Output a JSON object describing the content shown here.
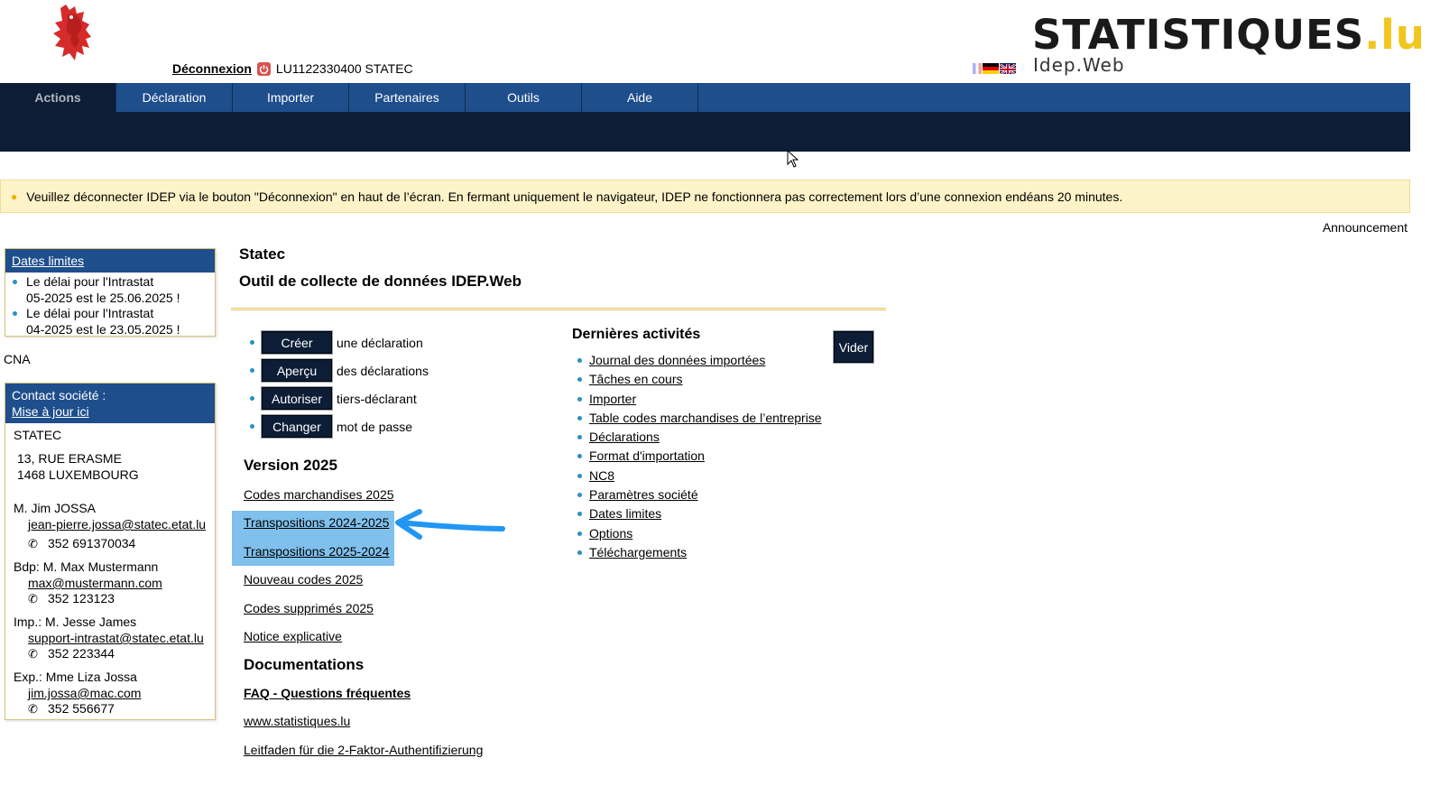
{
  "header": {
    "logout_label": "Déconnexion",
    "user_id": "LU1122330400 STATEC",
    "brand_main": "STATISTIQUES",
    "brand_tld": ".lu",
    "brand_sub": "Idep.Web"
  },
  "nav": {
    "items": [
      {
        "label": "Actions",
        "active": true
      },
      {
        "label": "Déclaration"
      },
      {
        "label": "Importer"
      },
      {
        "label": "Partenaires"
      },
      {
        "label": "Outils"
      },
      {
        "label": "Aide"
      }
    ]
  },
  "alert": {
    "text": "Veuillez déconnecter IDEP via le bouton \"Déconnexion\" en haut de l’écran. En fermant uniquement le navigateur, IDEP ne fonctionnera pas correctement lors d’une connexion endéans 20 minutes."
  },
  "announcement": "Announcement",
  "deadlines": {
    "title": "Dates limites",
    "items": [
      {
        "line1": "Le délai pour l'Intrastat",
        "line2": "05-2025 est le 25.06.2025 !"
      },
      {
        "line1": "Le délai pour l'Intrastat",
        "line2": "04-2025 est le 23.05.2025 !"
      }
    ]
  },
  "cna": "CNA",
  "contact": {
    "title": "Contact société :",
    "update_link": "Mise à jour ici",
    "company": "STATEC",
    "street": "13, RUE ERASME",
    "city": "1468 LUXEMBOURG",
    "people": [
      {
        "name": "M. Jim JOSSA",
        "email": "jean-pierre.jossa@statec.etat.lu",
        "phone": "352 691370034"
      },
      {
        "name": "Bdp: M. Max Mustermann",
        "email": "max@mustermann.com",
        "phone": "352 123123"
      },
      {
        "name": "Imp.: M. Jesse James",
        "email": "support-intrastat@statec.etat.lu",
        "phone": "352 223344"
      },
      {
        "name": "Exp.: Mme Liza Jossa",
        "email": "jim.jossa@mac.com",
        "phone": "352 556677"
      }
    ]
  },
  "main": {
    "title": "Statec",
    "subtitle": "Outil de collecte de données IDEP.Web",
    "actions": [
      {
        "button": "Créer",
        "text": "une déclaration"
      },
      {
        "button": "Aperçu",
        "text": "des déclarations"
      },
      {
        "button": "Autoriser",
        "text": "tiers-déclarant"
      },
      {
        "button": "Changer",
        "text": "mot de passe"
      }
    ],
    "version_title": "Version 2025",
    "version_links": [
      "Codes marchandises 2025",
      "Transpositions 2024-2025",
      "Transpositions 2025-2024",
      "Nouveau codes 2025",
      "Codes supprimés 2025",
      "Notice explicative"
    ],
    "docs_title": "Documentations",
    "doc_links": [
      "FAQ - Questions fréquentes",
      "www.statistiques.lu",
      "Leitfaden für die 2-Faktor-Authentifizierung"
    ]
  },
  "recent": {
    "title": "Dernières activités",
    "clear_button": "Vider",
    "links": [
      "Journal des données importées",
      "Tâches en cours",
      "Importer",
      "Table codes marchandises de l’entreprise",
      "Déclarations",
      "Format d'importation",
      "NC8",
      "Paramètres société",
      "Dates limites",
      "Options",
      "Téléchargements"
    ]
  },
  "colors": {
    "nav_blue": "#1f4e8c",
    "nav_dark": "#0d1d36",
    "alert_bg": "#fdf3c9",
    "highlight": "#7fc0ec",
    "arrow": "#2196f3",
    "brand_yellow": "#f0c61e"
  },
  "icons": [
    "lion-logo-icon",
    "power-icon",
    "flag-fr-icon",
    "flag-de-icon",
    "flag-uk-icon",
    "lightbulb-icon",
    "phone-icon",
    "mouse-cursor-icon",
    "annotation-arrow-icon"
  ]
}
